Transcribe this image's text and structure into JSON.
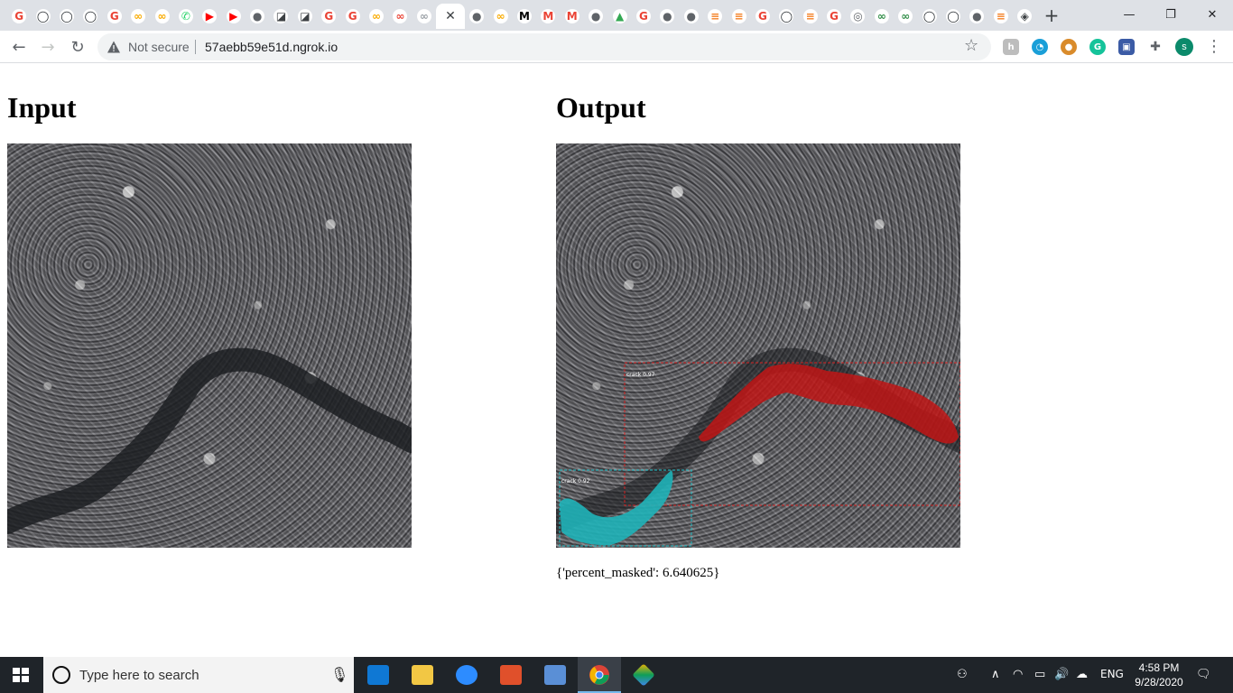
{
  "browser": {
    "tabs": [
      {
        "icon": "google-icon",
        "glyph": "G",
        "color": "#ea4335"
      },
      {
        "icon": "github-icon",
        "glyph": "◯",
        "color": "#24292e"
      },
      {
        "icon": "github-icon",
        "glyph": "◯",
        "color": "#24292e"
      },
      {
        "icon": "github-icon",
        "glyph": "◯",
        "color": "#24292e"
      },
      {
        "icon": "google-icon",
        "glyph": "G",
        "color": "#ea4335"
      },
      {
        "icon": "colab-icon",
        "glyph": "∞",
        "color": "#f9ab00"
      },
      {
        "icon": "colab-icon",
        "glyph": "∞",
        "color": "#f9ab00"
      },
      {
        "icon": "whatsapp-icon",
        "glyph": "✆",
        "color": "#25d366"
      },
      {
        "icon": "youtube-icon",
        "glyph": "▶",
        "color": "#ff0000"
      },
      {
        "icon": "youtube-icon",
        "glyph": "▶",
        "color": "#ff0000"
      },
      {
        "icon": "web-icon",
        "glyph": "●",
        "color": "#5f6368"
      },
      {
        "icon": "notion-icon",
        "glyph": "◪",
        "color": "#3c4043"
      },
      {
        "icon": "notion-icon",
        "glyph": "◪",
        "color": "#3c4043"
      },
      {
        "icon": "google-icon",
        "glyph": "G",
        "color": "#ea4335"
      },
      {
        "icon": "google-icon",
        "glyph": "G",
        "color": "#ea4335"
      },
      {
        "icon": "colab-icon",
        "glyph": "∞",
        "color": "#f9ab00"
      },
      {
        "icon": "colab-icon",
        "glyph": "∞",
        "color": "#ea4335"
      },
      {
        "icon": "colab-icon",
        "glyph": "∞",
        "color": "#9aa0a6"
      },
      {
        "icon": "close-icon",
        "glyph": "✕",
        "color": "#3c4043",
        "active": true
      },
      {
        "icon": "web-icon",
        "glyph": "●",
        "color": "#5f6368"
      },
      {
        "icon": "colab-icon",
        "glyph": "∞",
        "color": "#f9ab00"
      },
      {
        "icon": "medium-icon",
        "glyph": "M",
        "color": "#000000"
      },
      {
        "icon": "gmail-icon",
        "glyph": "M",
        "color": "#ea4335"
      },
      {
        "icon": "gmail-icon",
        "glyph": "M",
        "color": "#ea4335"
      },
      {
        "icon": "web-icon",
        "glyph": "●",
        "color": "#5f6368"
      },
      {
        "icon": "drive-icon",
        "glyph": "▲",
        "color": "#34a853"
      },
      {
        "icon": "google-icon",
        "glyph": "G",
        "color": "#ea4335"
      },
      {
        "icon": "web-icon",
        "glyph": "●",
        "color": "#5f6368"
      },
      {
        "icon": "web-icon",
        "glyph": "●",
        "color": "#5f6368"
      },
      {
        "icon": "stackoverflow-icon",
        "glyph": "≡",
        "color": "#f48024"
      },
      {
        "icon": "stackoverflow-icon",
        "glyph": "≡",
        "color": "#f48024"
      },
      {
        "icon": "google-icon",
        "glyph": "G",
        "color": "#ea4335"
      },
      {
        "icon": "github-icon",
        "glyph": "◯",
        "color": "#24292e"
      },
      {
        "icon": "stackoverflow-icon",
        "glyph": "≡",
        "color": "#f48024"
      },
      {
        "icon": "google-icon",
        "glyph": "G",
        "color": "#ea4335"
      },
      {
        "icon": "web-icon",
        "glyph": "◎",
        "color": "#5f6368"
      },
      {
        "icon": "geeksforgeeks-icon",
        "glyph": "∞",
        "color": "#2f8d46"
      },
      {
        "icon": "geeksforgeeks-icon",
        "glyph": "∞",
        "color": "#2f8d46"
      },
      {
        "icon": "github-icon",
        "glyph": "◯",
        "color": "#24292e"
      },
      {
        "icon": "github-icon",
        "glyph": "◯",
        "color": "#24292e"
      },
      {
        "icon": "web-icon",
        "glyph": "●",
        "color": "#5f6368"
      },
      {
        "icon": "stackoverflow-icon",
        "glyph": "≡",
        "color": "#f48024"
      },
      {
        "icon": "web-icon",
        "glyph": "◈",
        "color": "#3c4043"
      }
    ],
    "security_label": "Not secure",
    "url": "57aebb59e51d.ngrok.io",
    "profile_initial": "s"
  },
  "page": {
    "input_heading": "Input",
    "output_heading": "Output",
    "result_text": "{'percent_masked': 6.640625}",
    "detections": [
      {
        "label": "crack 0.97",
        "color": "#d42020"
      },
      {
        "label": "crack 0.92",
        "color": "#20c0c8"
      }
    ]
  },
  "taskbar": {
    "search_placeholder": "Type here to search",
    "language": "ENG",
    "time": "4:58 PM",
    "date": "9/28/2020"
  }
}
